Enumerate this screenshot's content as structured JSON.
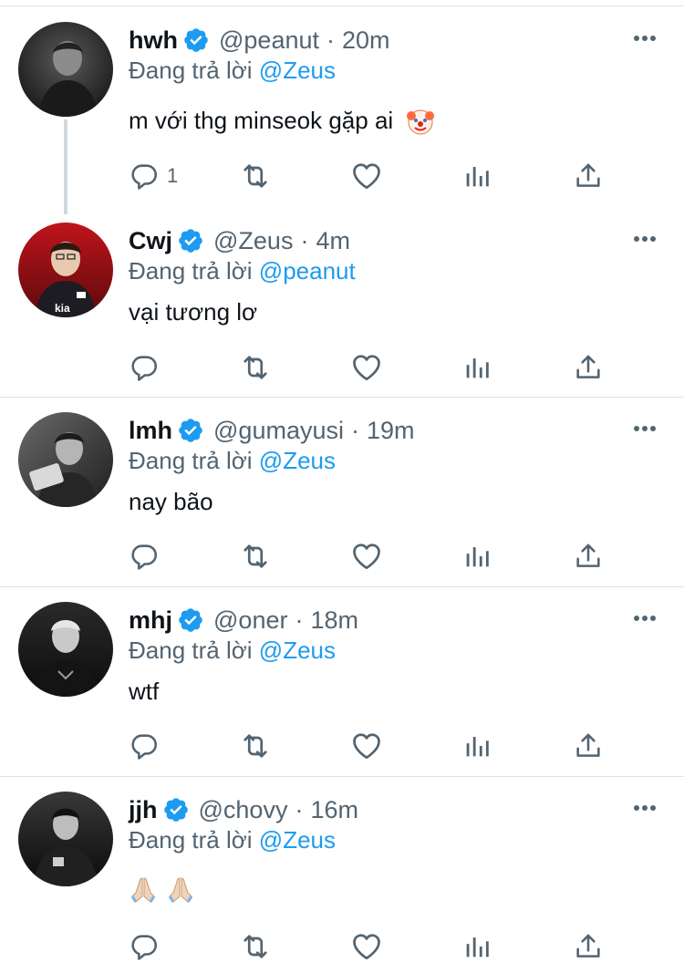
{
  "colors": {
    "link": "#1d9bf0",
    "secondary_text": "#536471",
    "primary_text": "#0f1419",
    "divider": "#dde3e8",
    "verified_badge": "#1d9bf0"
  },
  "tweets": [
    {
      "display_name": "hwh",
      "handle": "@peanut",
      "separator": "·",
      "time": "20m",
      "replying_prefix": "Đang trả lời",
      "replying_to": "@Zeus",
      "text": "m với thg minseok gặp ai",
      "text_emoji": "clown-face-emoji",
      "reply_count": "1",
      "has_thread_line": true,
      "avatar_icon": "user-avatar-photo"
    },
    {
      "display_name": "Cwj",
      "handle": "@Zeus",
      "separator": "·",
      "time": "4m",
      "replying_prefix": "Đang trả lời",
      "replying_to": "@peanut",
      "text": "vại tương lơ",
      "reply_count": "",
      "avatar_icon": "user-avatar-photo"
    },
    {
      "display_name": "lmh",
      "handle": "@gumayusi",
      "separator": "·",
      "time": "19m",
      "replying_prefix": "Đang trả lời",
      "replying_to": "@Zeus",
      "text": "nay bão",
      "reply_count": "",
      "avatar_icon": "user-avatar-photo"
    },
    {
      "display_name": "mhj",
      "handle": "@oner",
      "separator": "·",
      "time": "18m",
      "replying_prefix": "Đang trả lời",
      "replying_to": "@Zeus",
      "text": "wtf",
      "reply_count": "",
      "avatar_icon": "user-avatar-photo"
    },
    {
      "display_name": "jjh",
      "handle": "@chovy",
      "separator": "·",
      "time": "16m",
      "replying_prefix": "Đang trả lời",
      "replying_to": "@Zeus",
      "text": "",
      "text_emoji": "folded-hands-emoji-x2",
      "reply_count": "",
      "avatar_icon": "user-avatar-photo"
    }
  ],
  "action_icons": [
    "reply-icon",
    "retweet-icon",
    "like-icon",
    "analytics-icon",
    "share-icon"
  ],
  "menu_icon": "more-options-icon"
}
